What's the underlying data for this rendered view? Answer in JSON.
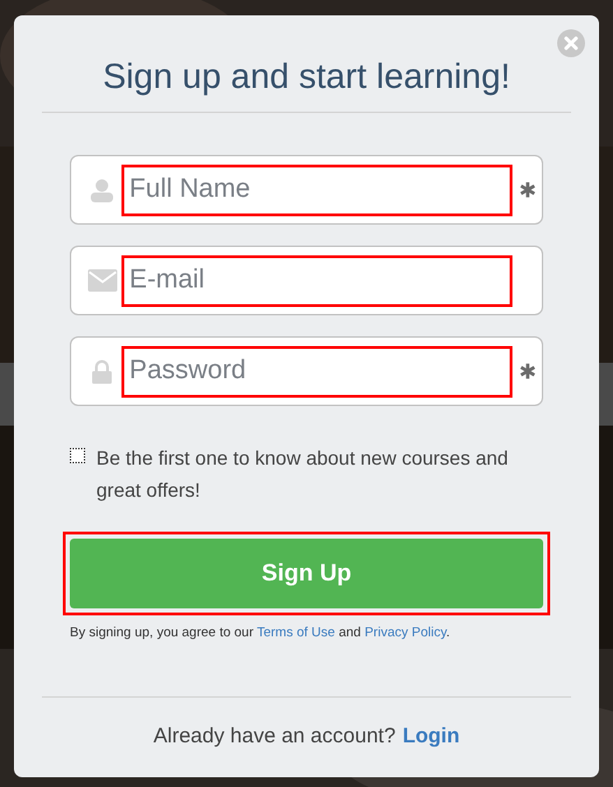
{
  "dialog": {
    "title": "Sign up and start learning!",
    "fields": [
      {
        "kind": "user",
        "placeholder": "Full Name",
        "required": true
      },
      {
        "kind": "mail",
        "placeholder": "E-mail",
        "required": false
      },
      {
        "kind": "lock",
        "placeholder": "Password",
        "required": true
      }
    ],
    "newsletter": {
      "label": "Be the first one to know about new courses and great offers!",
      "checked": false
    },
    "submit": "Sign Up",
    "terms": {
      "prefix": "By signing up, you agree to our",
      "terms_link": "Terms of Use",
      "middle": "and",
      "privacy_link": "Privacy Policy",
      "suffix": "."
    },
    "footer": {
      "question": "Already have an account?",
      "link": "Login"
    }
  }
}
